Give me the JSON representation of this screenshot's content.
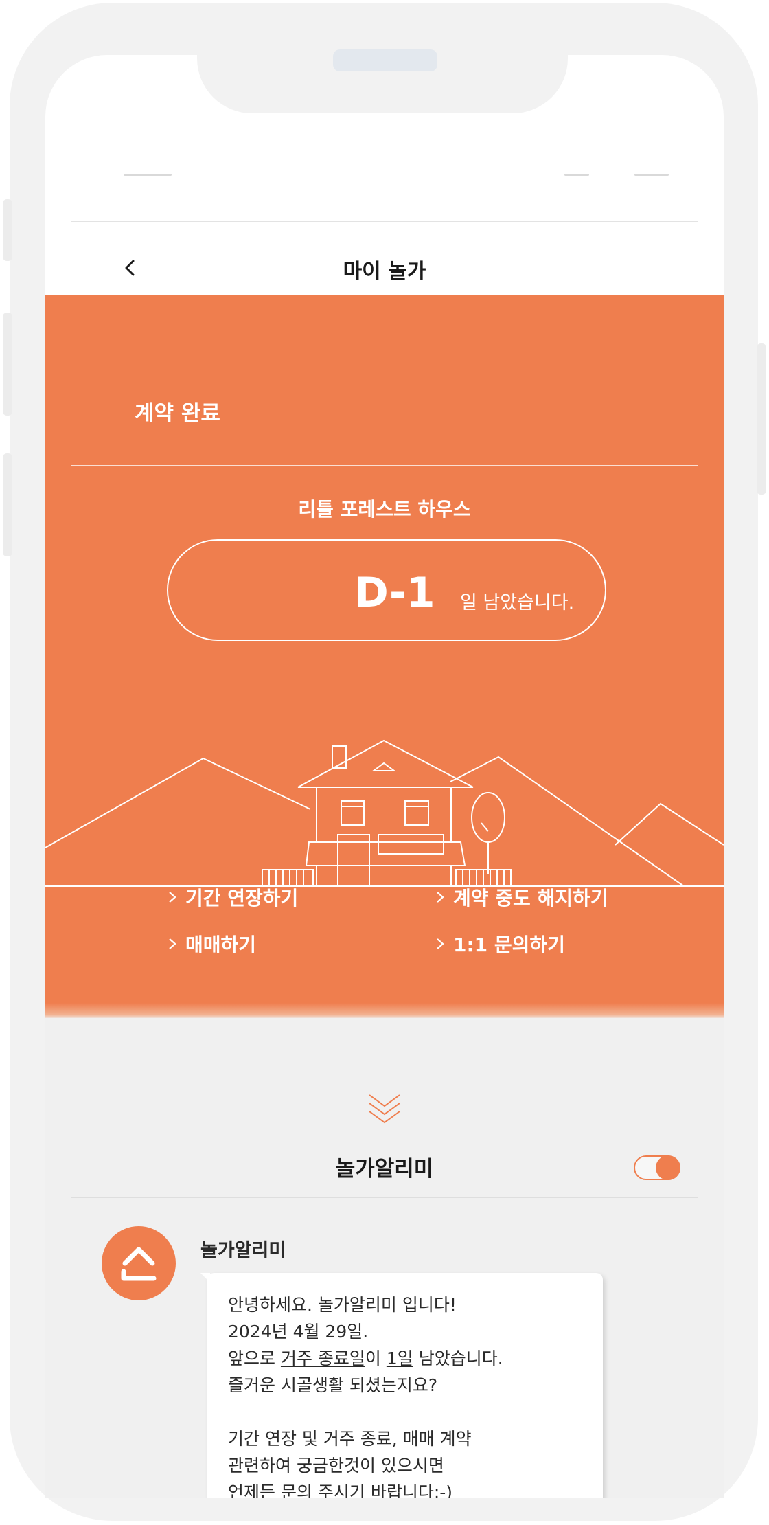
{
  "header": {
    "title": "마이 놀가"
  },
  "contract": {
    "status_label": "계약 완료",
    "house_name": "리틀 포레스트 하우스",
    "dday_value": "D-1",
    "dday_suffix": "일 남았습니다."
  },
  "actions": [
    {
      "label": "기간 연장하기"
    },
    {
      "label": "계약 중도 해지하기"
    },
    {
      "label": "매매하기"
    },
    {
      "label": "1:1 문의하기"
    }
  ],
  "alarm": {
    "title": "놀가알리미",
    "toggle_on": true,
    "sender": "놀가알리미",
    "message": {
      "line1": "안녕하세요. 놀가알리미 입니다!",
      "line2": "2024년 4월 29일.",
      "line3_prefix": "앞으로 ",
      "line3_u1": "거주 종료일",
      "line3_mid": "이 ",
      "line3_u2": "1일",
      "line3_suffix": " 남았습니다.",
      "line4": "즐거운 시골생활 되셨는지요?",
      "line5": "기간 연장 및 거주 종료, 매매 계약",
      "line6": "관련하여 궁금한것이 있으시면",
      "line7": "언제든 문의 주시기 바랍니다:-)"
    }
  },
  "colors": {
    "accent": "#ef7e4e",
    "background_gray": "#f0f0f0",
    "text_dark": "#1a1a1a"
  },
  "icons": {
    "back": "chevron-left-icon",
    "action": "chevron-right-icon",
    "scroll_down": "double-chevron-down-icon",
    "avatar": "house-logo-icon"
  }
}
